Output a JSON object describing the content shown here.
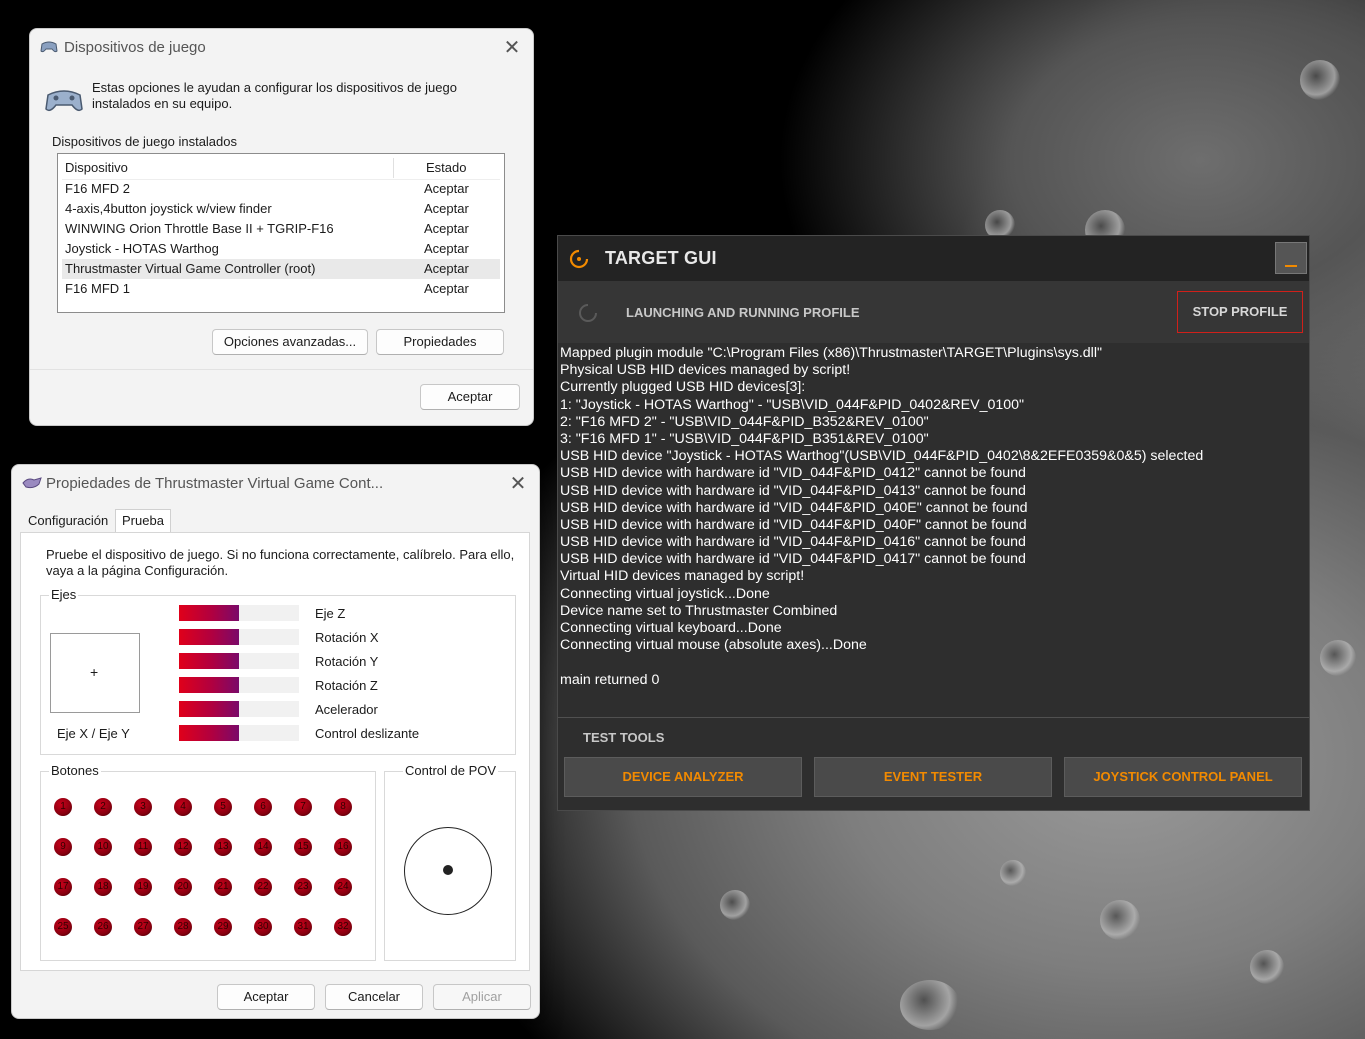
{
  "game_devices_window": {
    "title": "Dispositivos de juego",
    "description": "Estas opciones le ayudan a configurar los dispositivos de juego instalados en su equipo.",
    "installed_label": "Dispositivos de juego instalados",
    "columns": [
      "Dispositivo",
      "Estado"
    ],
    "devices": [
      {
        "name": "F16 MFD 2",
        "status": "Aceptar"
      },
      {
        "name": "4-axis,4button joystick w/view finder",
        "status": "Aceptar"
      },
      {
        "name": "WINWING Orion Throttle Base II + TGRIP-F16",
        "status": "Aceptar"
      },
      {
        "name": "Joystick - HOTAS Warthog",
        "status": "Aceptar"
      },
      {
        "name": "Thrustmaster Virtual Game Controller (root)",
        "status": "Aceptar"
      },
      {
        "name": "F16 MFD 1",
        "status": "Aceptar"
      }
    ],
    "advanced_button": "Opciones avanzadas...",
    "properties_button": "Propiedades",
    "ok_button": "Aceptar"
  },
  "properties_window": {
    "title": "Propiedades de Thrustmaster Virtual Game Cont...",
    "tabs": [
      "Configuración",
      "Prueba"
    ],
    "active_tab": "Prueba",
    "instructions": "Pruebe el dispositivo de juego. Si no funciona correctamente, calíbrelo. Para ello, vaya a la página Configuración.",
    "axes_group": "Ejes",
    "xy_label": "Eje X / Eje Y",
    "xy_crosshair": "+",
    "axes": [
      {
        "label": "Eje Z",
        "level": 0.5
      },
      {
        "label": "Rotación X",
        "level": 0.5
      },
      {
        "label": "Rotación Y",
        "level": 0.5
      },
      {
        "label": "Rotación Z",
        "level": 0.5
      },
      {
        "label": "Acelerador",
        "level": 0.5
      },
      {
        "label": "Control deslizante",
        "level": 0.5
      }
    ],
    "buttons_group": "Botones",
    "buttons": [
      "1",
      "2",
      "3",
      "4",
      "5",
      "6",
      "7",
      "8",
      "9",
      "10",
      "11",
      "12",
      "13",
      "14",
      "15",
      "16",
      "17",
      "18",
      "19",
      "20",
      "21",
      "22",
      "23",
      "24",
      "25",
      "26",
      "27",
      "28",
      "29",
      "30",
      "31",
      "32"
    ],
    "pov_group": "Control de POV",
    "ok_button": "Aceptar",
    "cancel_button": "Cancelar",
    "apply_button": "Aplicar"
  },
  "target_gui": {
    "title": "TARGET GUI",
    "minimize_glyph": "_",
    "status": "LAUNCHING AND RUNNING PROFILE",
    "stop_button": "STOP PROFILE",
    "log_lines": [
      "Mapped plugin module \"C:\\Program Files (x86)\\Thrustmaster\\TARGET\\Plugins\\sys.dll\"",
      "Physical USB HID devices managed by script!",
      "Currently plugged USB HID devices[3]:",
      "1: \"Joystick - HOTAS Warthog\" - \"USB\\VID_044F&PID_0402&REV_0100\"",
      "2: \"F16 MFD 2\" - \"USB\\VID_044F&PID_B352&REV_0100\"",
      "3: \"F16 MFD 1\" - \"USB\\VID_044F&PID_B351&REV_0100\"",
      "USB HID device \"Joystick - HOTAS Warthog\"(USB\\VID_044F&PID_0402\\8&2EFE0359&0&5) selected",
      "USB HID device with hardware id \"VID_044F&PID_0412\" cannot be found",
      "USB HID device with hardware id \"VID_044F&PID_0413\" cannot be found",
      "USB HID device with hardware id \"VID_044F&PID_040E\" cannot be found",
      "USB HID device with hardware id \"VID_044F&PID_040F\" cannot be found",
      "USB HID device with hardware id \"VID_044F&PID_0416\" cannot be found",
      "USB HID device with hardware id \"VID_044F&PID_0417\" cannot be found",
      "Virtual HID devices managed by script!",
      "Connecting virtual joystick...Done",
      "Device name set to Thrustmaster Combined",
      "Connecting virtual keyboard...Done",
      "Connecting virtual mouse (absolute axes)...Done",
      "",
      "main returned 0"
    ],
    "tools_label": "TEST TOOLS",
    "tool_buttons": [
      "DEVICE ANALYZER",
      "EVENT TESTER",
      "JOYSTICK CONTROL PANEL"
    ],
    "accent_color": "#f28a00",
    "stop_border_color": "#d0201a"
  }
}
